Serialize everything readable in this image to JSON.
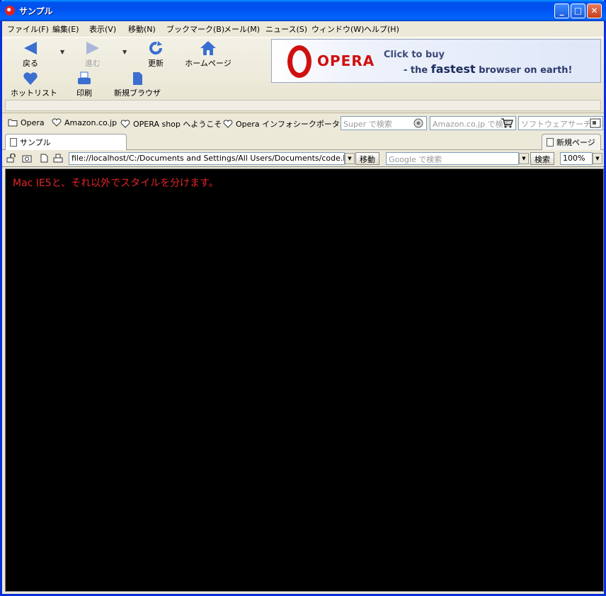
{
  "window": {
    "title": "サンプル",
    "controls": {
      "minimize": "_",
      "maximize": "□",
      "close": "✕"
    }
  },
  "menu": [
    "ファイル(F)",
    "編集(E)",
    "表示(V)",
    "移動(N)",
    "ブックマーク(B)",
    "メール(M)",
    "ニュース(S)",
    "ウィンドウ(W)",
    "ヘルプ(H)"
  ],
  "toolbar": {
    "back": "戻る",
    "forward": "進む",
    "reload": "更新",
    "home": "ホームページ",
    "hotlist": "ホットリスト",
    "print": "印刷",
    "new_browser": "新規ブラウザ"
  },
  "banner": {
    "brand": "OPERA",
    "line1": "Click to buy",
    "line2_prefix": "- the ",
    "line2_emphasis": "fastest",
    "line2_suffix": " browser on earth!"
  },
  "bookmarks": [
    {
      "label": "Opera",
      "icon": "folder-icon"
    },
    {
      "label": "Amazon.co.jp",
      "icon": "heart-icon"
    },
    {
      "label": "OPERA shop へようこそ",
      "icon": "heart-icon"
    },
    {
      "label": "Opera インフォシークポータル",
      "icon": "heart-icon"
    }
  ],
  "search_fields": {
    "super": "Super で検索",
    "amazon": "Amazon.co.jp で検索",
    "software": "ソフトウェアサーチ で検索"
  },
  "tabs": {
    "active": "サンプル",
    "new_page": "新規ページ"
  },
  "address": {
    "url": "file://localhost/C:/Documents and Settings/All Users/Documents/code.html",
    "go_button": "移動",
    "google_placeholder": "Google で検索",
    "search_button": "検索",
    "zoom": "100%"
  },
  "content": {
    "text": "Mac IE5と、それ以外でスタイルを分けます。",
    "background": "#000000",
    "text_color": "#e0252a"
  }
}
